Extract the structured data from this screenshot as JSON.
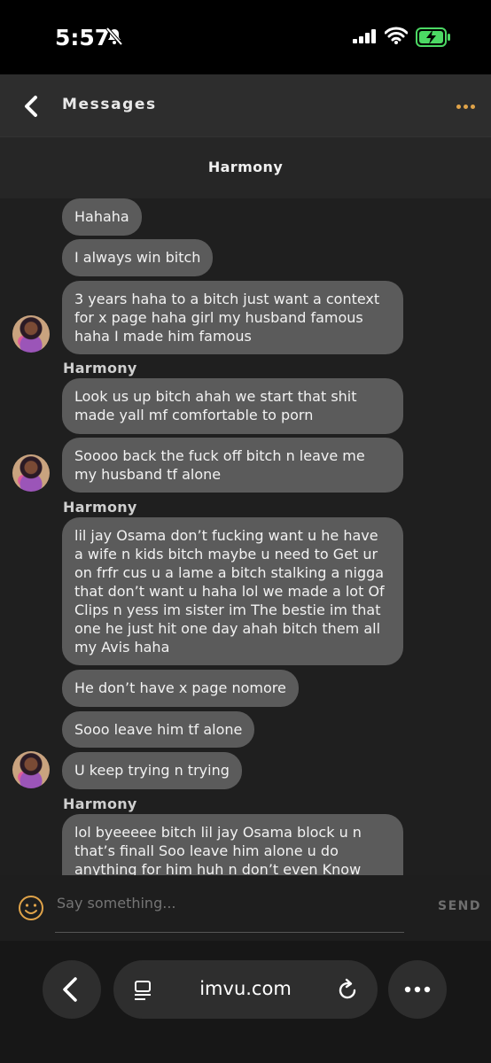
{
  "status_bar": {
    "time": "5:57"
  },
  "header": {
    "back_label": "Messages",
    "more_icon": "ellipsis-icon",
    "accent_color": "#e0a349"
  },
  "conversation": {
    "title": "Harmony"
  },
  "messages": [
    {
      "text": "Hahaha"
    },
    {
      "text": "I always win bitch"
    },
    {
      "text": "3 years haha to a bitch just want a context for x page haha girl my husband famous haha I made him famous"
    },
    {
      "text": "Look us up bitch ahah we start that shit made yall mf comfortable to porn"
    },
    {
      "text": "Soooo back the fuck off bitch n leave me my husband tf alone"
    },
    {
      "text": "lil jay Osama don’t fucking want u he have a wife n kids bitch maybe u need to Get ur on frfr cus u a lame a bitch stalking a nigga that don’t want u haha lol we made a lot Of Clips n yess im sister im The bestie im that one he just hit one day ahah bitch them all my Avis haha"
    },
    {
      "text": "He don’t have x page nomore"
    },
    {
      "text": "Sooo leave him tf alone"
    },
    {
      "text": "U keep trying n trying"
    },
    {
      "text": "lol byeeeee bitch lil jay Osama block u n that’s finall Soo leave him alone u do anything for him huh n don’t even Know"
    }
  ],
  "senders": [
    "Harmony",
    "Harmony",
    "Harmony"
  ],
  "composer": {
    "placeholder": "Say something...",
    "send_label": "SEND"
  },
  "browser": {
    "url": "imvu.com"
  }
}
